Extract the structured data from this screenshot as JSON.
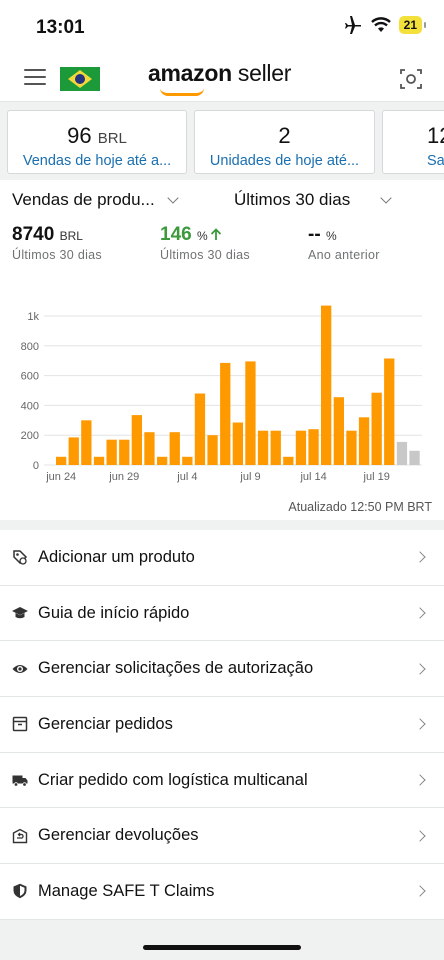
{
  "status_bar": {
    "time": "13:01",
    "battery": "21"
  },
  "header": {
    "logo_brand": "amazon",
    "logo_suffix": " seller"
  },
  "cards": [
    {
      "value": "96",
      "unit": "BRL",
      "label": "Vendas de hoje até a..."
    },
    {
      "value": "2",
      "unit": "",
      "label": "Unidades de hoje até..."
    },
    {
      "value": "12",
      "unit": "",
      "label": "Sa"
    }
  ],
  "sales": {
    "metric_dropdown": "Vendas de produ...",
    "period_dropdown": "Últimos 30 dias",
    "metrics": [
      {
        "value": "8740",
        "unit": "BRL",
        "sub": "Últimos 30 dias"
      },
      {
        "value": "146",
        "unit": "%",
        "sub": "Últimos 30 dias"
      },
      {
        "value": "--",
        "unit": "%",
        "sub": "Ano anterior"
      }
    ],
    "updated": "Atualizado 12:50 PM BRT"
  },
  "chart_data": {
    "type": "bar",
    "y_ticks": [
      "0",
      "200",
      "400",
      "600",
      "800",
      "1k"
    ],
    "ylim": [
      0,
      1000
    ],
    "x_tick_labels": [
      "jun 24",
      "jun 29",
      "jul 4",
      "jul 9",
      "jul 14",
      "jul 19"
    ],
    "values": [
      55,
      185,
      300,
      55,
      170,
      170,
      335,
      220,
      55,
      220,
      55,
      480,
      200,
      685,
      285,
      695,
      230,
      230,
      55,
      230,
      240,
      1070,
      455,
      230,
      320,
      485,
      715,
      155,
      95
    ],
    "bar_colors": [
      "orange",
      "orange",
      "orange",
      "orange",
      "orange",
      "orange",
      "orange",
      "orange",
      "orange",
      "orange",
      "orange",
      "orange",
      "orange",
      "orange",
      "orange",
      "orange",
      "orange",
      "orange",
      "orange",
      "orange",
      "orange",
      "orange",
      "orange",
      "orange",
      "orange",
      "orange",
      "orange",
      "grey",
      "grey"
    ],
    "palette": {
      "orange": "#ff9900",
      "grey": "#c8c8c8"
    },
    "grid": true
  },
  "menu": [
    {
      "icon": "tag-icon",
      "label": "Adicionar um produto"
    },
    {
      "icon": "graduation-cap-icon",
      "label": "Guia de início rápido"
    },
    {
      "icon": "eye-icon",
      "label": "Gerenciar solicitações de autorização"
    },
    {
      "icon": "box-icon",
      "label": "Gerenciar pedidos"
    },
    {
      "icon": "truck-icon",
      "label": "Criar pedido com logística multicanal"
    },
    {
      "icon": "return-box-icon",
      "label": "Gerenciar devoluções"
    },
    {
      "icon": "shield-icon",
      "label": "Manage SAFE T Claims"
    }
  ]
}
